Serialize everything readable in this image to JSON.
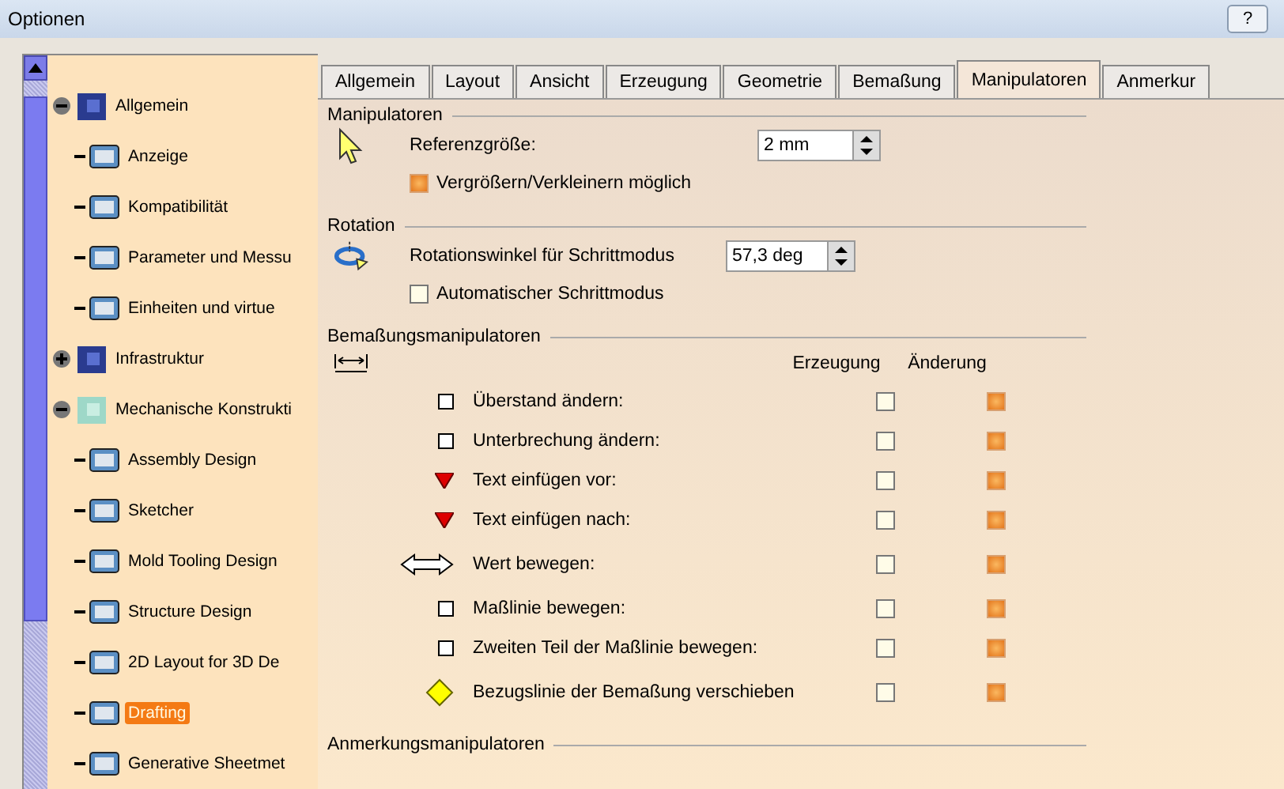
{
  "window": {
    "title": "Optionen",
    "help_button": "?"
  },
  "tree": [
    {
      "label": "Allgemein",
      "expanded": true,
      "selected": false,
      "children": [
        {
          "label": "Anzeige",
          "selected": false
        },
        {
          "label": "Kompatibilität",
          "selected": false
        },
        {
          "label": "Parameter und Messu",
          "selected": false
        },
        {
          "label": "Einheiten und virtue",
          "selected": false
        }
      ]
    },
    {
      "label": "Infrastruktur",
      "expanded": false,
      "selected": false
    },
    {
      "label": "Mechanische Konstrukti",
      "expanded": true,
      "selected": false,
      "children": [
        {
          "label": "Assembly Design",
          "selected": false
        },
        {
          "label": "Sketcher",
          "selected": false
        },
        {
          "label": "Mold Tooling Design",
          "selected": false
        },
        {
          "label": "Structure Design",
          "selected": false
        },
        {
          "label": "2D Layout for 3D De",
          "selected": false
        },
        {
          "label": "Drafting",
          "selected": true
        },
        {
          "label": "Generative Sheetmet",
          "selected": false
        }
      ]
    }
  ],
  "tabs": [
    {
      "label": "Allgemein",
      "selected": false
    },
    {
      "label": "Layout",
      "selected": false
    },
    {
      "label": "Ansicht",
      "selected": false
    },
    {
      "label": "Erzeugung",
      "selected": false
    },
    {
      "label": "Geometrie",
      "selected": false
    },
    {
      "label": "Bemaßung",
      "selected": false
    },
    {
      "label": "Manipulatoren",
      "selected": true
    },
    {
      "label": "Anmerkur",
      "selected": false
    }
  ],
  "manipulatoren": {
    "title": "Manipulatoren",
    "size_label": "Referenzgröße:",
    "size_value": "2 mm",
    "scale_option": {
      "label": "Vergrößern/Verkleinern möglich",
      "checked": true
    }
  },
  "rotation": {
    "title": "Rotation",
    "angle_label": "Rotationswinkel für Schrittmodus",
    "angle_value": "57,3 deg",
    "auto_option": {
      "label": "Automatischer Schrittmodus",
      "checked": false
    }
  },
  "bemassung": {
    "title": "Bemaßungsmanipulatoren",
    "columns": [
      "Erzeugung",
      "Änderung"
    ],
    "rows": [
      {
        "kind": "square",
        "label": "Überstand ändern:",
        "create": false,
        "modify": true
      },
      {
        "kind": "square",
        "label": "Unterbrechung ändern:",
        "create": false,
        "modify": true
      },
      {
        "kind": "triangle",
        "label": "Text einfügen vor:",
        "create": false,
        "modify": true
      },
      {
        "kind": "triangle",
        "label": "Text einfügen nach:",
        "create": false,
        "modify": true
      },
      {
        "kind": "arrow",
        "label": "Wert bewegen:",
        "create": false,
        "modify": true
      },
      {
        "kind": "square",
        "label": "Maßlinie bewegen:",
        "create": false,
        "modify": true
      },
      {
        "kind": "square",
        "label": "Zweiten Teil der Maßlinie bewegen:",
        "create": false,
        "modify": true
      },
      {
        "kind": "diamond",
        "label": "Bezugslinie der Bemaßung verschieben",
        "create": false,
        "modify": true
      }
    ]
  },
  "anmerkung": {
    "title": "Anmerkungsmanipulatoren"
  }
}
